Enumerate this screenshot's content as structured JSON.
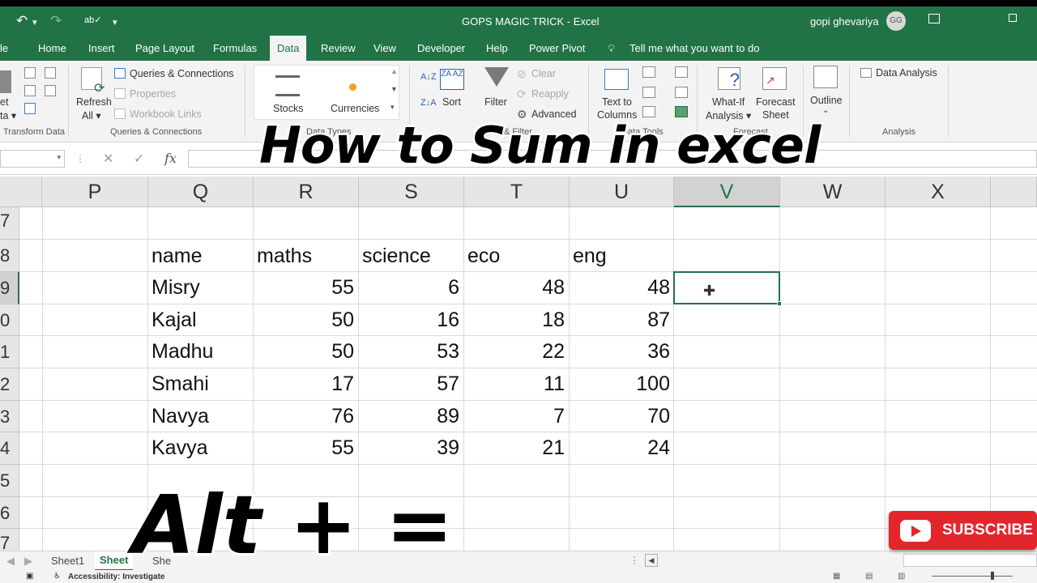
{
  "window": {
    "title": "GOPS MAGIC TRICK  -  Excel",
    "user": "gopi ghevariya",
    "avatar": "GG"
  },
  "menu": {
    "tabs": [
      "le",
      "Home",
      "Insert",
      "Page Layout",
      "Formulas",
      "Data",
      "Review",
      "View",
      "Developer",
      "Help",
      "Power Pivot"
    ],
    "active": "Data",
    "tell_me": "Tell me what you want to do"
  },
  "ribbon": {
    "get_transform": {
      "partial": [
        "et",
        "ta ▾"
      ],
      "group_label": "Transform Data"
    },
    "queries": {
      "refresh_label": "Refresh",
      "refresh_all": "All ▾",
      "queries_connections": "Queries & Connections",
      "properties": "Properties",
      "workbook_links": "Workbook Links",
      "group_label": "Queries & Connections"
    },
    "data_types": {
      "stocks": "Stocks",
      "currencies": "Currencies",
      "group_label": "Data Types"
    },
    "sort_filter": {
      "sort": "Sort",
      "filter": "Filter",
      "clear": "Clear",
      "reapply": "Reapply",
      "advanced": "Advanced",
      "group_label": "& Filter"
    },
    "data_tools": {
      "text_to_columns": "Text to",
      "columns": "Columns",
      "group_label": "Data Tools"
    },
    "forecast": {
      "what_if": "What-If",
      "analysis": "Analysis ▾",
      "forecast_sheet": "Forecast",
      "sheet": "Sheet",
      "group_label": "Forecast"
    },
    "outline": {
      "label": "Outline"
    },
    "analysis": {
      "data_analysis": "Data Analysis",
      "group_label": "Analysis"
    }
  },
  "formula_bar": {
    "fx": "fx"
  },
  "grid": {
    "columns": [
      "P",
      "Q",
      "R",
      "S",
      "T",
      "U",
      "V",
      "W",
      "X"
    ],
    "selected_column": "V",
    "rows": [
      "7",
      "8",
      "9",
      "0",
      "1",
      "2",
      "3",
      "4",
      "5",
      "6",
      "7"
    ],
    "headers": [
      "name",
      "maths",
      "science",
      "eco",
      "eng"
    ],
    "data": [
      {
        "name": "Misry",
        "maths": "55",
        "science": "6",
        "eco": "48",
        "eng": "48"
      },
      {
        "name": "Kajal",
        "maths": "50",
        "science": "16",
        "eco": "18",
        "eng": "87"
      },
      {
        "name": "Madhu",
        "maths": "50",
        "science": "53",
        "eco": "22",
        "eng": "36"
      },
      {
        "name": "Smahi",
        "maths": "17",
        "science": "57",
        "eco": "11",
        "eng": "100"
      },
      {
        "name": "Navya",
        "maths": "76",
        "science": "89",
        "eco": "7",
        "eng": "70"
      },
      {
        "name": "Kavya",
        "maths": "55",
        "science": "39",
        "eco": "21",
        "eng": "24"
      }
    ]
  },
  "sheets": {
    "tabs": [
      "Sheet1",
      "Sheet",
      "She"
    ],
    "active": "Sheet"
  },
  "status": {
    "accessibility": "Accessibility: Investigate"
  },
  "overlay": {
    "title": "How to Sum in excel",
    "keys": "Alt + =",
    "subscribe": "SUBSCRIBE"
  },
  "colors": {
    "excel_green": "#217346",
    "subscribe_red": "#e3262c"
  }
}
